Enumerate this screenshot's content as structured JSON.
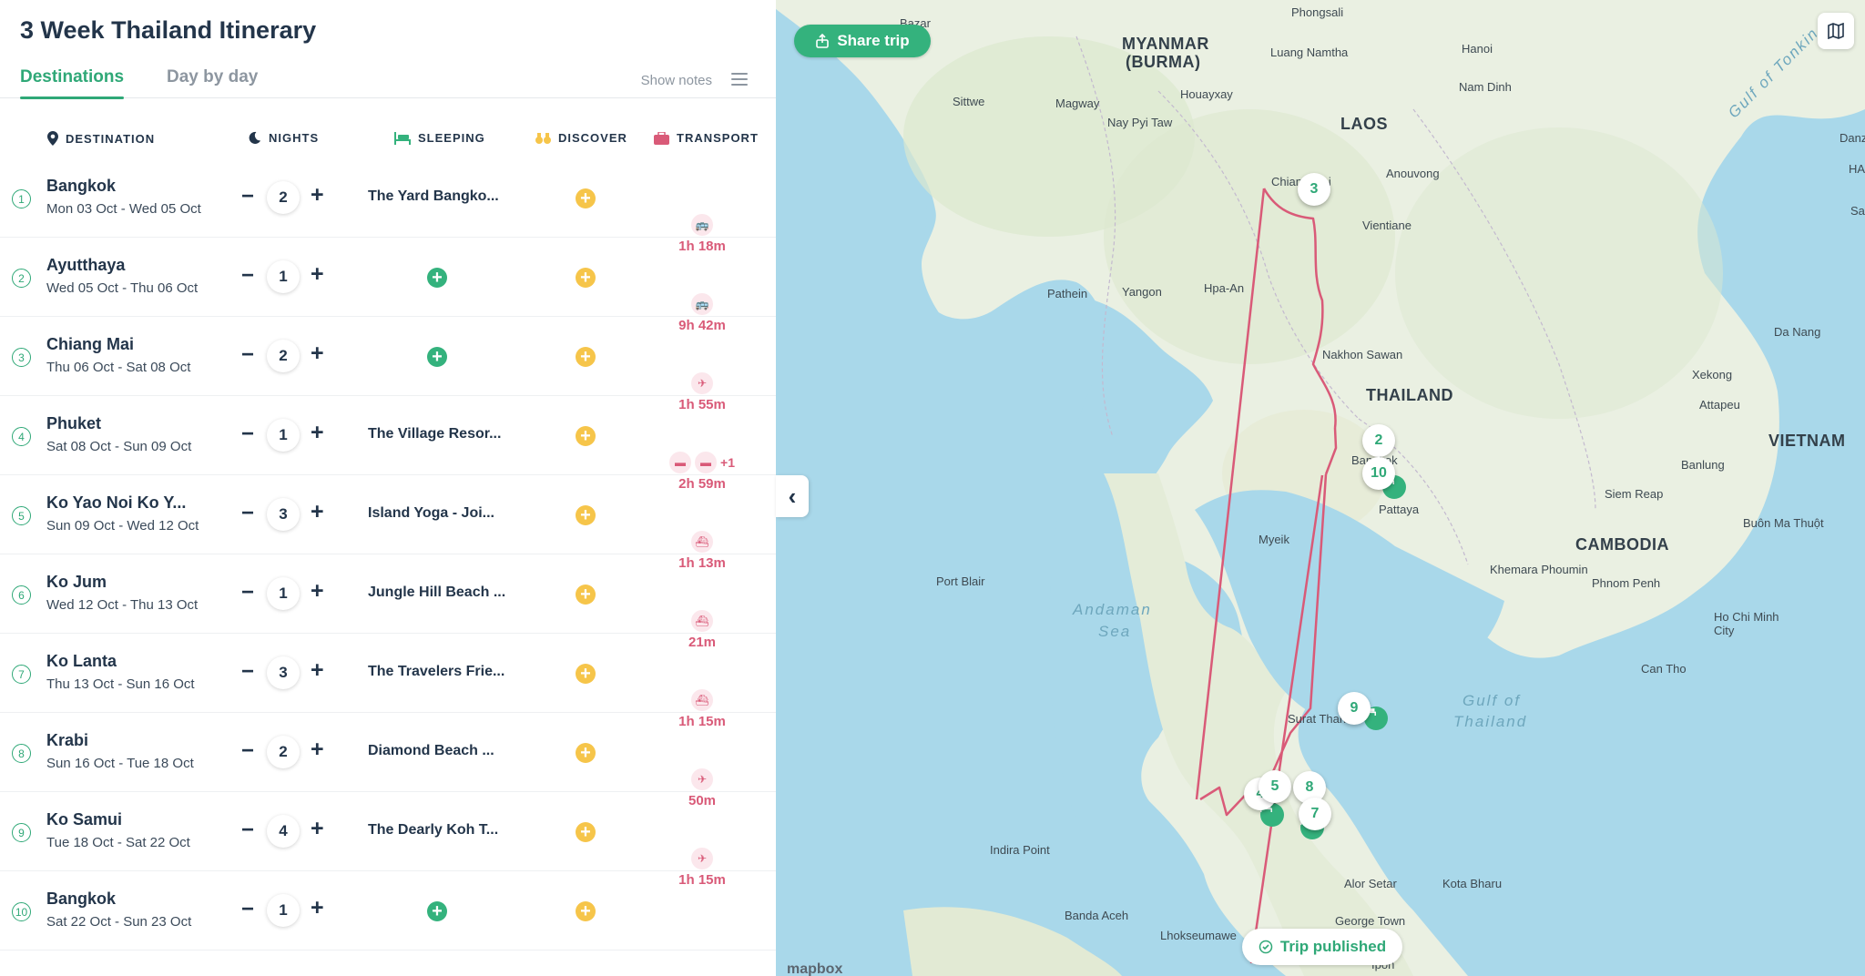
{
  "trip": {
    "title": "3 Week Thailand Itinerary"
  },
  "tabs": {
    "destinations": "Destinations",
    "day_by_day": "Day by day",
    "show_notes": "Show notes"
  },
  "columns": {
    "destination": "DESTINATION",
    "nights": "NIGHTS",
    "sleeping": "SLEEPING",
    "discover": "DISCOVER",
    "transport": "TRANSPORT"
  },
  "stops": [
    {
      "num": "1",
      "name": "Bangkok",
      "dates": "Mon 03 Oct - Wed 05 Oct",
      "nights": "2",
      "sleeping": "The Yard Bangko..."
    },
    {
      "num": "2",
      "name": "Ayutthaya",
      "dates": "Wed 05 Oct - Thu 06 Oct",
      "nights": "1",
      "sleeping": ""
    },
    {
      "num": "3",
      "name": "Chiang Mai",
      "dates": "Thu 06 Oct - Sat 08 Oct",
      "nights": "2",
      "sleeping": ""
    },
    {
      "num": "4",
      "name": "Phuket",
      "dates": "Sat 08 Oct - Sun 09 Oct",
      "nights": "1",
      "sleeping": "The Village Resor..."
    },
    {
      "num": "5",
      "name": "Ko Yao Noi Ko Y...",
      "dates": "Sun 09 Oct - Wed 12 Oct",
      "nights": "3",
      "sleeping": "Island Yoga - Joi..."
    },
    {
      "num": "6",
      "name": "Ko Jum",
      "dates": "Wed 12 Oct - Thu 13 Oct",
      "nights": "1",
      "sleeping": "Jungle Hill Beach ..."
    },
    {
      "num": "7",
      "name": "Ko Lanta",
      "dates": "Thu 13 Oct - Sun 16 Oct",
      "nights": "3",
      "sleeping": "The Travelers Frie..."
    },
    {
      "num": "8",
      "name": "Krabi",
      "dates": "Sun 16 Oct - Tue 18 Oct",
      "nights": "2",
      "sleeping": "Diamond Beach ..."
    },
    {
      "num": "9",
      "name": "Ko Samui",
      "dates": "Tue 18 Oct - Sat 22 Oct",
      "nights": "4",
      "sleeping": "The Dearly Koh T..."
    },
    {
      "num": "10",
      "name": "Bangkok",
      "dates": "Sat 22 Oct - Sun 23 Oct",
      "nights": "1",
      "sleeping": ""
    }
  ],
  "transport": [
    {
      "mode": "bus-icon",
      "duration": "1h 18m"
    },
    {
      "mode": "bus-icon",
      "duration": "9h 42m"
    },
    {
      "mode": "plane-icon",
      "duration": "1h 55m"
    },
    {
      "mode": "multi",
      "extra": "+1",
      "duration": "2h 59m"
    },
    {
      "mode": "ferry-icon",
      "duration": "1h 13m"
    },
    {
      "mode": "ferry-icon",
      "duration": "21m"
    },
    {
      "mode": "ferry-icon",
      "duration": "1h 15m"
    },
    {
      "mode": "plane-icon",
      "duration": "50m"
    },
    {
      "mode": "plane-icon",
      "duration": "1h 15m"
    }
  ],
  "map": {
    "share": "Share trip",
    "published": "Trip published",
    "attribution": "mapbox",
    "countries": [
      "MYANMAR",
      "(BURMA)",
      "LAOS",
      "THAILAND",
      "VIETNAM",
      "CAMBODIA"
    ],
    "seas": [
      "Andaman",
      "Sea",
      "Gulf of",
      "Thailand",
      "Gulf of Tonkin"
    ],
    "cities": [
      "Bazar",
      "Phongsali",
      "Hanoi",
      "Luang Namtha",
      "Nam Dinh",
      "Sittwe",
      "Magway",
      "Nay Pyi Taw",
      "Houayxay",
      "Chiang Mai",
      "Anouvong",
      "Vientiane",
      "Pathein",
      "Yangon",
      "Hpa-An",
      "Nakhon Sawan",
      "Da Nang",
      "Xekong",
      "Attapeu",
      "Bangkok",
      "Banlung",
      "Siem Reap",
      "Pattaya",
      "Buôn Ma Thuột",
      "Myeik",
      "Khemara Phoumin",
      "Phnom Penh",
      "Port Blair",
      "Ho Chi Minh City",
      "Can Tho",
      "Surat Thani",
      "Indira Point",
      "Alor Setar",
      "Kota Bharu",
      "Banda Aceh",
      "Lhokseumawe",
      "George Town",
      "Ipoh",
      "Danz",
      "HA",
      "Sa"
    ],
    "pins": [
      "3",
      "2",
      "10",
      "9",
      "8",
      "7",
      "4",
      "5"
    ]
  },
  "colors": {
    "accent": "#34b27d",
    "transport": "#d95a78",
    "discover": "#f6c54a",
    "route": "#d95a78",
    "land": "#eaf0e2",
    "water": "#a9d8ea"
  }
}
